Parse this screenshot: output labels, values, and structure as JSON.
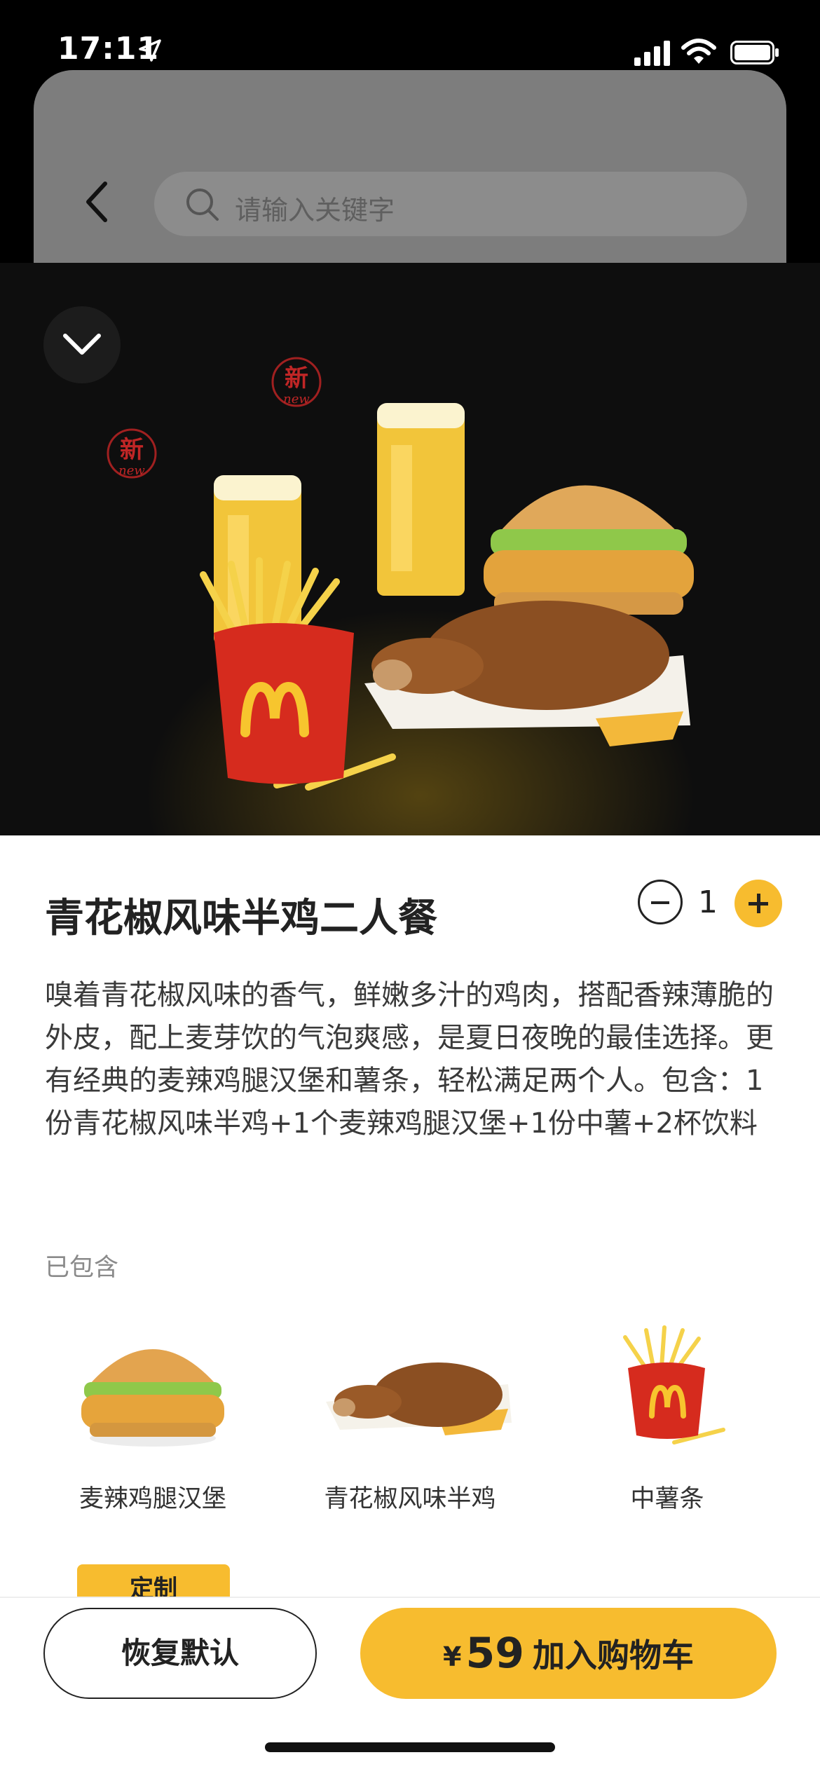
{
  "status_bar": {
    "time": "17:11"
  },
  "background_page": {
    "search_placeholder": "请输入关键字"
  },
  "product": {
    "title": "青花椒风味半鸡二人餐",
    "quantity": "1",
    "description": "嗅着青花椒风味的香气，鲜嫩多汁的鸡肉，搭配香辣薄脆的外皮，配上麦芽饮的气泡爽感，是夏日夜晚的最佳选择。更有经典的麦辣鸡腿汉堡和薯条，轻松满足两个人。包含：1份青花椒风味半鸡+1个麦辣鸡腿汉堡+1份中薯+2杯饮料",
    "badges": [
      "新",
      "新"
    ],
    "badge_sub": "new"
  },
  "included": {
    "label": "已包含",
    "items": [
      {
        "name": "麦辣鸡腿汉堡",
        "icon": "burger-icon"
      },
      {
        "name": "青花椒风味半鸡",
        "icon": "half-chicken-icon"
      },
      {
        "name": "中薯条",
        "icon": "fries-icon"
      }
    ],
    "customize_label": "定制"
  },
  "footer": {
    "reset_label": "恢复默认",
    "currency": "¥",
    "price": "59",
    "add_to_cart_label": "加入购物车"
  },
  "colors": {
    "accent": "#f7bc2f",
    "text": "#222222",
    "muted": "#8a8a8a"
  }
}
